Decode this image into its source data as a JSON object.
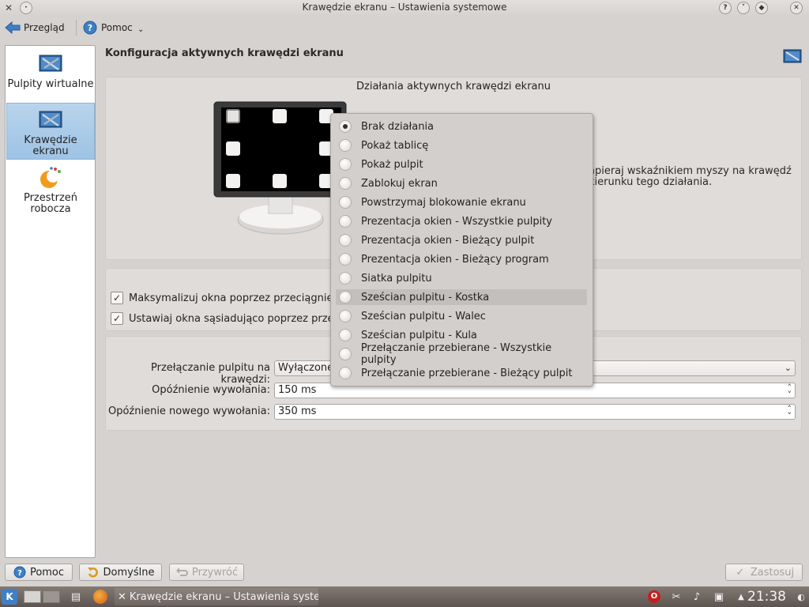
{
  "window": {
    "title": "Krawędzie ekranu – Ustawienia systemowe"
  },
  "toolbar": {
    "back_label": "Przegląd",
    "help_label": "Pomoc"
  },
  "sidebar": {
    "items": [
      {
        "label": "Pulpity wirtualne",
        "selected": false
      },
      {
        "label": "Krawędzie ekranu",
        "selected": true
      },
      {
        "label": "Przestrzeń robocza",
        "selected": false
      }
    ]
  },
  "page": {
    "title": "Konfiguracja aktywnych krawędzi ekranu",
    "group_caption": "Działania aktywnych krawędzi ekranu",
    "hint_line1": "apieraj wskaźnikiem myszy na krawędź",
    "hint_line2": "kierunku tego działania."
  },
  "options": {
    "maximize_label": "Maksymalizuj okna poprzez przeciągnięcie",
    "maximize_checked": true,
    "tile_label": "Ustawiaj okna sąsiadująco poprzez przeci",
    "tile_checked": true
  },
  "fields": {
    "desktop_switch_label": "Przełączanie pulpitu na krawędzi:",
    "desktop_switch_value": "Wyłączone",
    "activation_delay_label": "Opóźnienie wywołania:",
    "activation_delay_value": "150 ms",
    "reactivation_delay_label": "Opóźnienie nowego wywołania:",
    "reactivation_delay_value": "350 ms"
  },
  "menu": {
    "items": [
      {
        "label": "Brak działania",
        "checked": true
      },
      {
        "label": "Pokaż tablicę",
        "checked": false
      },
      {
        "label": "Pokaż pulpit",
        "checked": false
      },
      {
        "label": "Zablokuj ekran",
        "checked": false
      },
      {
        "label": "Powstrzymaj blokowanie ekranu",
        "checked": false
      },
      {
        "label": "Prezentacja okien - Wszystkie pulpity",
        "checked": false
      },
      {
        "label": "Prezentacja okien - Bieżący pulpit",
        "checked": false
      },
      {
        "label": "Prezentacja okien - Bieżący program",
        "checked": false
      },
      {
        "label": "Siatka pulpitu",
        "checked": false
      },
      {
        "label": "Sześcian pulpitu - Kostka",
        "checked": false
      },
      {
        "label": "Sześcian pulpitu - Walec",
        "checked": false
      },
      {
        "label": "Sześcian pulpitu - Kula",
        "checked": false
      },
      {
        "label": "Przełączanie przebierane - Wszystkie pulpity",
        "checked": false
      },
      {
        "label": "Przełączanie przebierane - Bieżący pulpit",
        "checked": false
      }
    ],
    "highlighted_index": 9
  },
  "buttons": {
    "help": "Pomoc",
    "defaults": "Domyślne",
    "reset": "Przywróć",
    "apply": "Zastosuj"
  },
  "taskbar": {
    "task_label": "Krawędzie ekranu – Ustawienia system",
    "clock": "21:38"
  },
  "colors": {
    "selection": "#9ec3e5",
    "window_bg": "#d6d2d0",
    "taskbar": "#6e6560"
  }
}
